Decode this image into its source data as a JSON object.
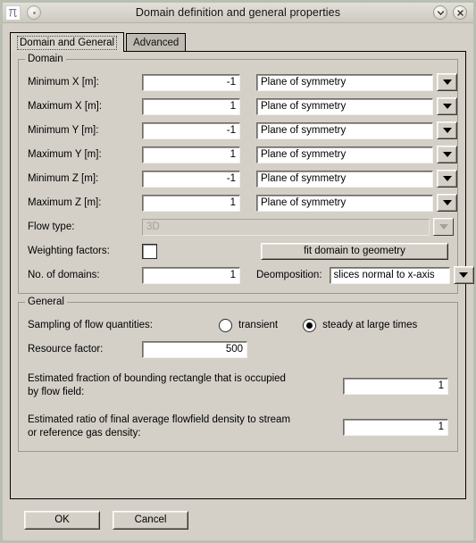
{
  "window": {
    "title": "Domain definition and general properties",
    "app_icon": "pi-glyph-icon",
    "menu_button": "window-menu-icon",
    "shade_button": "chevron-down-icon",
    "close_button": "close-icon"
  },
  "tabs": [
    {
      "label": "Domain and General",
      "active": true
    },
    {
      "label": "Advanced",
      "active": false
    }
  ],
  "domain": {
    "legend": "Domain",
    "rows": [
      {
        "label": "Minimum X [m]:",
        "value": "-1",
        "boundary": "Plane of symmetry"
      },
      {
        "label": "Maximum X [m]:",
        "value": "1",
        "boundary": "Plane of symmetry"
      },
      {
        "label": "Minimum Y [m]:",
        "value": "-1",
        "boundary": "Plane of symmetry"
      },
      {
        "label": "Maximum Y [m]:",
        "value": "1",
        "boundary": "Plane of symmetry"
      },
      {
        "label": "Minimum Z [m]:",
        "value": "-1",
        "boundary": "Plane of symmetry"
      },
      {
        "label": "Maximum Z [m]:",
        "value": "1",
        "boundary": "Plane of symmetry"
      }
    ],
    "flow_type": {
      "label": "Flow type:",
      "value": "3D",
      "disabled": true
    },
    "weighting": {
      "label": "Weighting factors:",
      "checked": false
    },
    "fit_button": "fit domain to geometry",
    "no_of_domains": {
      "label": "No. of domains:",
      "value": "1"
    },
    "decomposition": {
      "label": "Deomposition:",
      "value": "slices normal to  x-axis"
    }
  },
  "general": {
    "legend": "General",
    "sampling": {
      "label": "Sampling of flow quantities:",
      "options": [
        {
          "label": "transient",
          "selected": false
        },
        {
          "label": "steady at large times",
          "selected": true
        }
      ]
    },
    "resource_factor": {
      "label": "Resource factor:",
      "value": "500"
    },
    "fraction": {
      "line1": "Estimated fraction of bounding rectangle that is occupied",
      "line2": "by flow field:",
      "value": "1"
    },
    "ratio": {
      "line1": "Estimated ratio of final average flowfield density to stream",
      "line2": "or reference gas density:",
      "value": "1"
    }
  },
  "footer": {
    "ok": "OK",
    "cancel": "Cancel"
  },
  "colors": {
    "window_bg": "#d4d0c8",
    "frame": "#b9bfb2",
    "field_bg": "#ffffff"
  }
}
